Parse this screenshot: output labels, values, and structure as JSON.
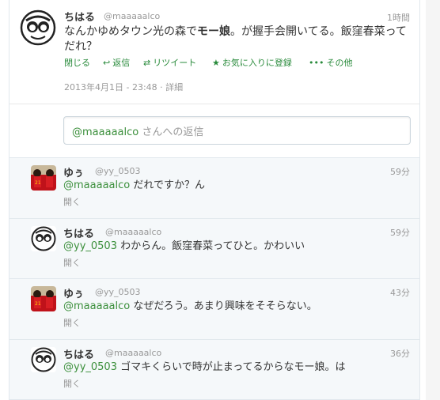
{
  "main_tweet": {
    "name": "ちはる",
    "handle": "@maaaaalco",
    "time": "1時間",
    "text_parts": [
      "なんかゆめタウン光の森で",
      "モー娘",
      "。が握手会開いてる。飯窪春菜ってだれ？"
    ],
    "actions": {
      "close": "閉じる",
      "reply": "返信",
      "retweet": "リツイート",
      "favorite": "お気に入りに登録",
      "more": "その他"
    },
    "timestamp": "2013年4月1日 - 23:48",
    "detail": "詳細"
  },
  "reply_box": {
    "mention": "@maaaaalco",
    "placeholder": " さんへの返信"
  },
  "replies": [
    {
      "name": "ゆぅ",
      "handle": "@yy_0503",
      "time": "59分",
      "mention": "@maaaaalco",
      "text": " だれですか？ん",
      "open": "開く",
      "avatar": "team-photo"
    },
    {
      "name": "ちはる",
      "handle": "@maaaaalco",
      "time": "59分",
      "mention": "@yy_0503",
      "text": " わからん。飯窪春菜ってひと。かわいい",
      "open": "開く",
      "avatar": "drawing"
    },
    {
      "name": "ゆぅ",
      "handle": "@yy_0503",
      "time": "43分",
      "mention": "@maaaaalco",
      "text": " なぜだろう。あまり興味をそそらない。",
      "open": "開く",
      "avatar": "team-photo"
    },
    {
      "name": "ちはる",
      "handle": "@maaaaalco",
      "time": "36分",
      "mention": "@yy_0503",
      "text": " ゴマキくらいで時が止まってるからなモー娘。は",
      "open": "開く",
      "avatar": "drawing"
    }
  ],
  "colors": {
    "action_green": "#2a8b3c",
    "mention_green": "#3b8f3b",
    "reply_bg": "#f5f8fa",
    "muted": "#999999"
  }
}
